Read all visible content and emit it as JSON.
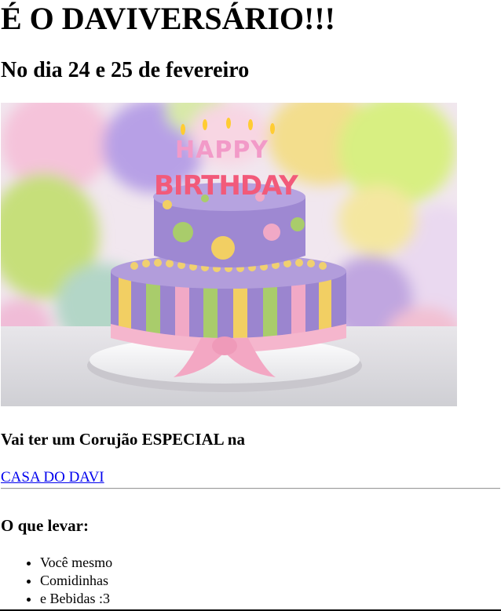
{
  "page": {
    "title": "É O DAVIVERSÁRIO!!!",
    "subtitle": "No dia 24 e 25 de fevereiro",
    "invite_text": "Vai ter um Corujão ESPECIAL na",
    "location_link": "CASA DO DAVI",
    "bring_heading": "O que levar:",
    "bring_items": [
      "Você mesmo",
      "Comidinhas",
      "e Bebidas :3"
    ]
  },
  "image": {
    "topper_line1": "HAPPY",
    "topper_line2": "BIRTHDAY"
  },
  "colors": {
    "link": "#0000ee",
    "cake_purple": "#9b85cf",
    "cake_stripe_green": "#a9cc6b",
    "cake_stripe_yellow": "#f2cf63",
    "cake_stripe_pink": "#f1a9c6",
    "ribbon_pink": "#f5b6cd"
  }
}
